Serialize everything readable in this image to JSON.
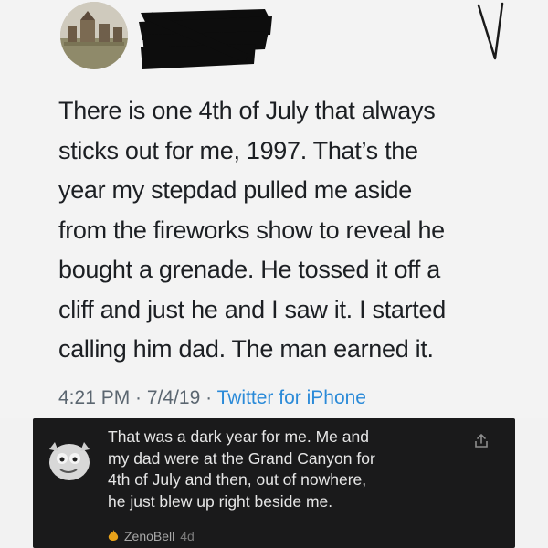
{
  "tweet": {
    "text": "There is one 4th of July that always\nsticks out for me, 1997. That’s the\nyear my stepdad pulled me aside\nfrom the fireworks show to reveal he\nbought a grenade. He tossed it off a\ncliff and just he and I saw it. I started\ncalling him dad. The man earned it.",
    "time": "4:21 PM",
    "separator": " · ",
    "date": "7/4/19",
    "source": "Twitter for iPhone"
  },
  "comment": {
    "text": "That was a dark year for me. Me and\nmy dad were at the Grand Canyon for\n4th of July and then, out of nowhere,\nhe just blew up right beside me.",
    "username": "ZenoBell",
    "time_ago": "4d"
  },
  "icons": {
    "avatar": "profile-avatar",
    "chevron": "chevron-down-icon",
    "share": "share-icon",
    "flame": "flame-icon"
  },
  "colors": {
    "link_blue": "#2a8ad8",
    "comment_bg": "#1a1a1b",
    "meta_gray": "#5b6670"
  }
}
